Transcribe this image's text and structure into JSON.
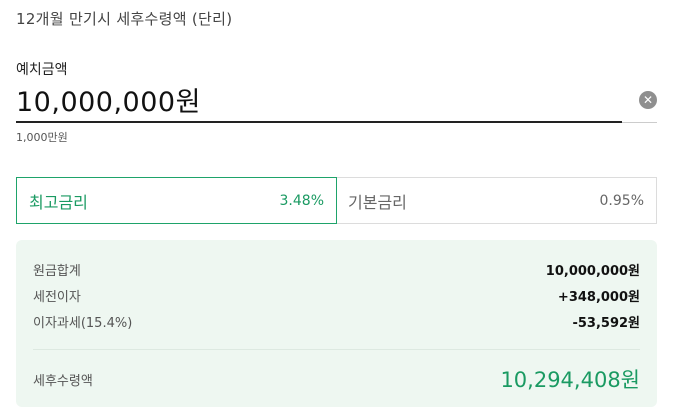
{
  "header": {
    "title": "12개월 만기시 세후수령액 (단리)"
  },
  "deposit": {
    "label": "예치금액",
    "value": "10,000,000원",
    "hint": "1,000만원",
    "clear_icon": "close-icon"
  },
  "rate_tabs": [
    {
      "label": "최고금리",
      "value": "3.48%",
      "selected": true
    },
    {
      "label": "기본금리",
      "value": "0.95%",
      "selected": false
    }
  ],
  "summary": {
    "rows": [
      {
        "label": "원금합계",
        "value": "10,000,000원"
      },
      {
        "label": "세전이자",
        "value": "+348,000원"
      },
      {
        "label": "이자과세(15.4%)",
        "value": "-53,592원"
      }
    ],
    "total": {
      "label": "세후수령액",
      "value": "10,294,408원"
    }
  },
  "colors": {
    "accent": "#1a9a62",
    "summary_bg": "#eef7f1",
    "border": "#dcdcdc"
  }
}
